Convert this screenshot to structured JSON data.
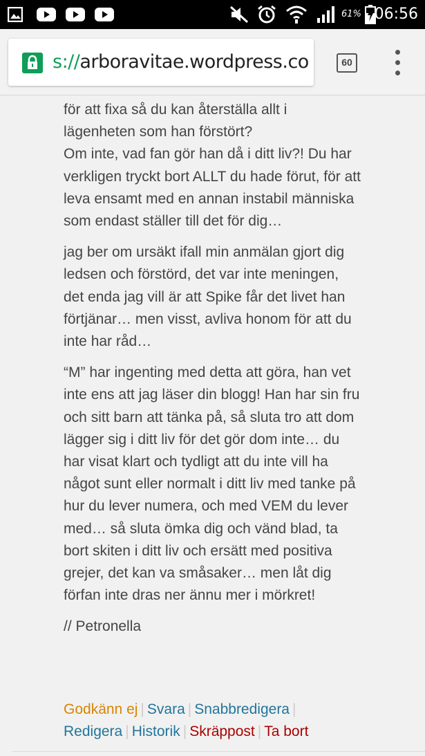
{
  "status_bar": {
    "left_icons": [
      "gallery-icon",
      "youtube-icon",
      "youtube-icon",
      "youtube-icon"
    ],
    "right_icons": [
      "mute-icon",
      "alarm-icon",
      "wifi-icon",
      "signal-icon",
      "battery-icon"
    ],
    "battery_percent": "61%",
    "time": "06:56"
  },
  "browser": {
    "url_scheme": "s://",
    "url_host": "arboravitae.wordpress.com/w",
    "url_scheme_prefix": "ɔ",
    "tab_count": "60"
  },
  "comment": {
    "paragraphs": [
      "för att fixa så du kan återställa allt i lägenheten som han förstört?\nOm inte, vad fan gör han då i ditt liv?! Du har verkligen tryckt bort ALLT du hade förut, för att leva ensamt med en annan instabil människa som endast ställer till det för dig…",
      "jag ber om ursäkt ifall min anmälan gjort dig ledsen och förstörd, det var inte meningen, det enda jag vill är att Spike får det livet han förtjänar… men visst, avliva honom för att du inte har råd…",
      "“M” har ingenting med detta att göra, han vet inte ens att jag läser din blogg! Han har sin fru och sitt barn att tänka på, så sluta tro att dom lägger sig i ditt liv för det gör dom inte… du har visat klart och tydligt att du inte vill ha något sunt eller normalt i ditt liv med tanke på hur du lever numera, och med VEM du lever med… så sluta ömka dig och vänd blad, ta bort skiten i ditt liv och ersätt med positiva grejer, det kan va småsaker… men låt dig förfan inte dras ner ännu mer i mörkret!",
      "// Petronella"
    ]
  },
  "actions": {
    "approve": "Godkänn ej",
    "reply": "Svara",
    "quick_edit": "Snabbredigera",
    "edit": "Redigera",
    "history": "Historik",
    "spam": "Skräppost",
    "trash": "Ta bort",
    "separator": "|"
  },
  "colors": {
    "approve": "#d98500",
    "link": "#21759b",
    "danger": "#aa0000",
    "secure": "#0f9d58"
  }
}
